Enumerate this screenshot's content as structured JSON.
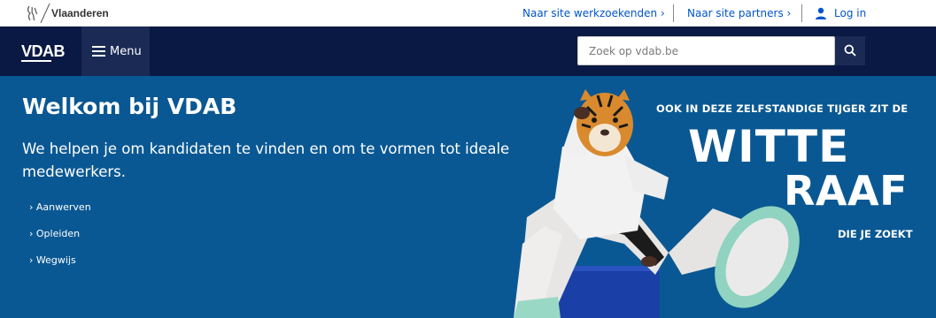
{
  "topbar": {
    "brand": "Vlaanderen",
    "links": {
      "jobseekers": "Naar site werkzoekenden ›",
      "partners": "Naar site partners ›"
    },
    "login": "Log in",
    "colors": {
      "link": "#0055cc"
    }
  },
  "navbar": {
    "logo": "VDAB",
    "menu_label": "Menu",
    "search": {
      "placeholder": "Zoek op vdab.be"
    },
    "colors": {
      "background": "#0a1943",
      "menu": "#1a2a55"
    }
  },
  "hero": {
    "title": "Welkom bij VDAB",
    "text": "We helpen je om kandidaten te vinden en om te vormen tot ideale medewerkers.",
    "links": [
      "› Aanwerven",
      "› Opleiden",
      "› Wegwijs"
    ],
    "colors": {
      "background": "#0a5893"
    }
  },
  "campaign": {
    "line1": "OOK IN DEZE ZELFSTANDIGE TIJGER ZIT DE",
    "line2": "WITTE",
    "line3": "RAAF",
    "line4": "DIE JE ZOEKT"
  }
}
